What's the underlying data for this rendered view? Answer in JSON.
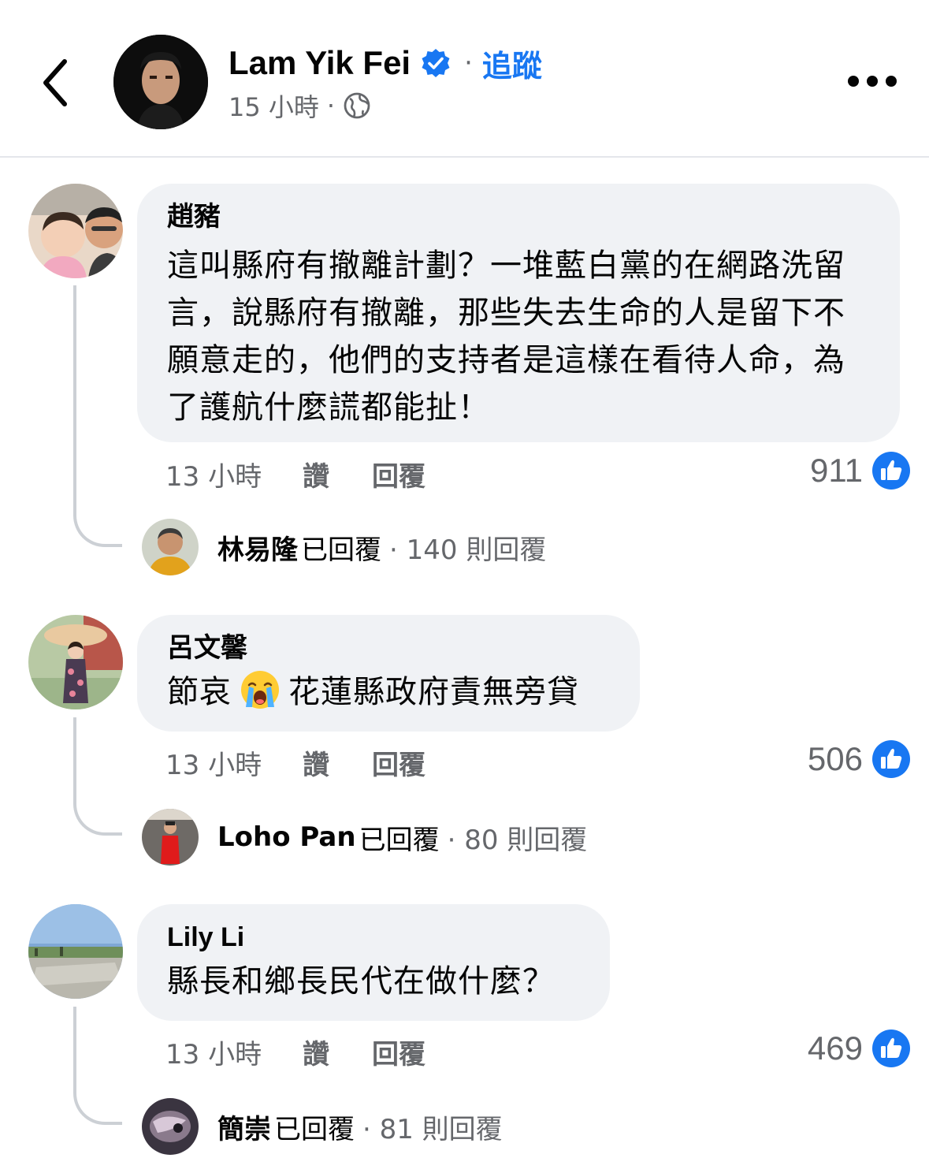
{
  "header": {
    "author_name": "Lam Yik Fei",
    "follow_label": "追蹤",
    "separator": "·",
    "timestamp": "15 小時",
    "meta_separator": "·",
    "icons": [
      "back-chevron-icon",
      "verified-badge-icon",
      "globe-icon",
      "more-options-icon"
    ]
  },
  "colors": {
    "accent": "#1877f2",
    "bubble_bg": "#f0f2f5",
    "secondary_text": "#65676b",
    "thread_line": "#ccd0d5"
  },
  "comments": [
    {
      "author": "趙豬",
      "text": "這叫縣府有撤離計劃？一堆藍白黨的在網路洗留言，說縣府有撤離，那些失去生命的人是留下不願意走的，他們的支持者是這樣在看待人命，為了護航什麼謊都能扯！",
      "time": "13 小時",
      "like_label": "讚",
      "reply_label": "回覆",
      "like_count": "911",
      "replier": "林易隆",
      "replied_text": "已回覆",
      "reply_count": "· 140 則回覆"
    },
    {
      "author": "呂文馨",
      "text_before_emoji": "節哀",
      "emoji": "loudly-crying-face-emoji",
      "text_after_emoji": "花蓮縣政府責無旁貸",
      "time": "13 小時",
      "like_label": "讚",
      "reply_label": "回覆",
      "like_count": "506",
      "replier": "Loho Pan",
      "replied_text": "已回覆",
      "reply_count": "· 80 則回覆"
    },
    {
      "author": "Lily Li",
      "text": "縣長和鄉長民代在做什麼？",
      "time": "13 小時",
      "like_label": "讚",
      "reply_label": "回覆",
      "like_count": "469",
      "replier": "簡崇",
      "replied_text": "已回覆",
      "reply_count": "· 81 則回覆"
    }
  ]
}
